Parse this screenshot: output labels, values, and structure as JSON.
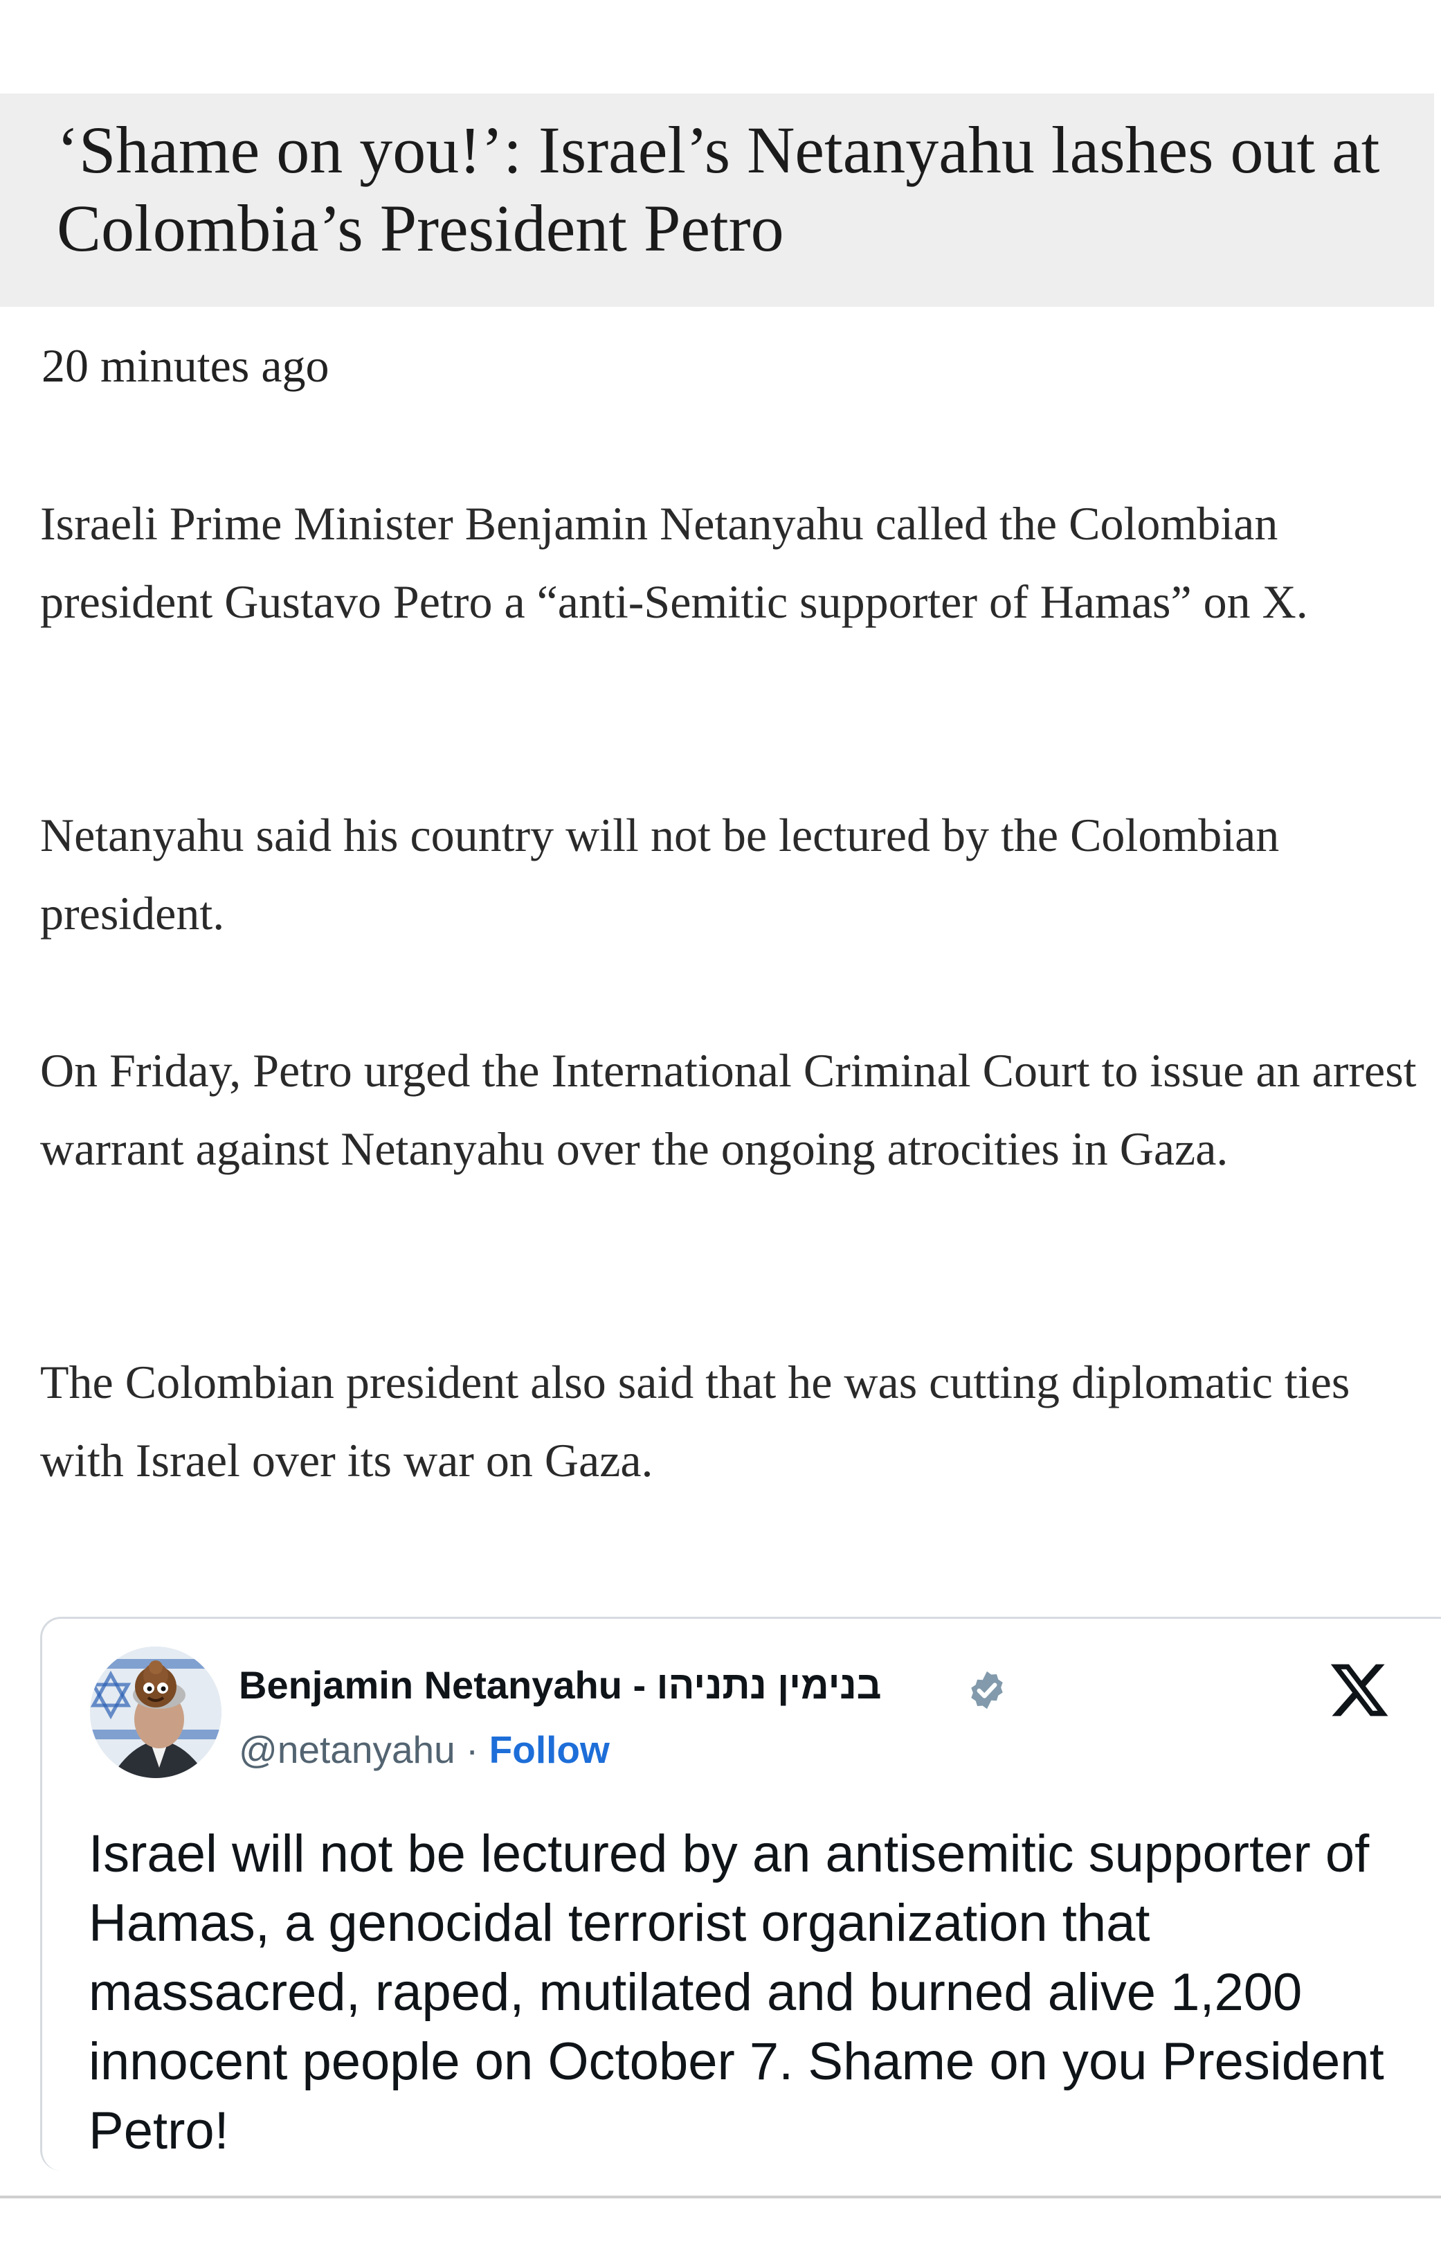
{
  "article": {
    "headline": "‘Shame on you!’: Israel’s Netanyahu lashes out at Colombia’s President Petro",
    "timestamp": "20 minutes ago",
    "paragraphs": [
      "Israeli Prime Minister Benjamin Netanyahu called the Colombian president Gustavo Petro a “anti-Semitic supporter of Hamas” on X.",
      "Netanyahu said his country will not be lectured by the Colombian president.",
      "On Friday, Petro urged the International Criminal Court to issue an arrest warrant against Netanyahu over the ongoing atrocities in Gaza.",
      "The Colombian president also said that he was cutting diplomatic ties with Israel over its war on Gaza."
    ]
  },
  "tweet": {
    "author_name": "Benjamin Netanyahu - בנימין נתניהו",
    "handle": "@netanyahu",
    "separator": "·",
    "follow_label": "Follow",
    "text": "Israel will not be lectured by an antisemitic supporter of Hamas, a genocidal terrorist organization that massacred, raped, mutilated and burned alive 1,200 innocent people on October 7. Shame on you President Petro!",
    "verified_icon": "verified-badge-icon",
    "platform_icon": "x-logo-icon",
    "colors": {
      "follow": "#1d6ed8",
      "verified": "#829aab",
      "handle": "#536471"
    }
  }
}
